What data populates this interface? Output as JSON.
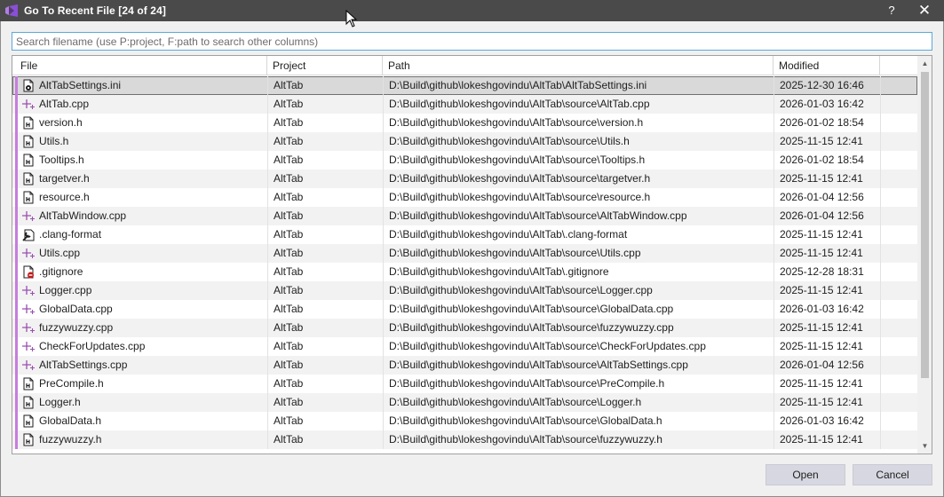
{
  "window": {
    "title": "Go To Recent File [24 of 24]",
    "help_label": "?",
    "close_label": "✕"
  },
  "search": {
    "placeholder": "Search filename (use P:project, F:path to search other columns)",
    "value": ""
  },
  "columns": {
    "file": "File",
    "project": "Project",
    "path": "Path",
    "modified": "Modified"
  },
  "rows": [
    {
      "icon": "settings-file-icon",
      "file": "AltTabSettings.ini",
      "project": "AltTab",
      "path": "D:\\Build\\github\\lokeshgovindu\\AltTab\\AltTabSettings.ini",
      "modified": "2025-12-30 16:46",
      "selected": true
    },
    {
      "icon": "cpp-file-icon",
      "file": "AltTab.cpp",
      "project": "AltTab",
      "path": "D:\\Build\\github\\lokeshgovindu\\AltTab\\source\\AltTab.cpp",
      "modified": "2026-01-03 16:42"
    },
    {
      "icon": "header-file-icon",
      "file": "version.h",
      "project": "AltTab",
      "path": "D:\\Build\\github\\lokeshgovindu\\AltTab\\source\\version.h",
      "modified": "2026-01-02 18:54"
    },
    {
      "icon": "header-file-icon",
      "file": "Utils.h",
      "project": "AltTab",
      "path": "D:\\Build\\github\\lokeshgovindu\\AltTab\\source\\Utils.h",
      "modified": "2025-11-15 12:41"
    },
    {
      "icon": "header-file-icon",
      "file": "Tooltips.h",
      "project": "AltTab",
      "path": "D:\\Build\\github\\lokeshgovindu\\AltTab\\source\\Tooltips.h",
      "modified": "2026-01-02 18:54"
    },
    {
      "icon": "header-file-icon",
      "file": "targetver.h",
      "project": "AltTab",
      "path": "D:\\Build\\github\\lokeshgovindu\\AltTab\\source\\targetver.h",
      "modified": "2025-11-15 12:41"
    },
    {
      "icon": "header-file-icon",
      "file": "resource.h",
      "project": "AltTab",
      "path": "D:\\Build\\github\\lokeshgovindu\\AltTab\\source\\resource.h",
      "modified": "2026-01-04 12:56"
    },
    {
      "icon": "cpp-file-icon",
      "file": "AltTabWindow.cpp",
      "project": "AltTab",
      "path": "D:\\Build\\github\\lokeshgovindu\\AltTab\\source\\AltTabWindow.cpp",
      "modified": "2026-01-04 12:56"
    },
    {
      "icon": "wrench-file-icon",
      "file": ".clang-format",
      "project": "AltTab",
      "path": "D:\\Build\\github\\lokeshgovindu\\AltTab\\.clang-format",
      "modified": "2025-11-15 12:41"
    },
    {
      "icon": "cpp-file-icon",
      "file": "Utils.cpp",
      "project": "AltTab",
      "path": "D:\\Build\\github\\lokeshgovindu\\AltTab\\source\\Utils.cpp",
      "modified": "2025-11-15 12:41"
    },
    {
      "icon": "gitignore-file-icon",
      "file": ".gitignore",
      "project": "AltTab",
      "path": "D:\\Build\\github\\lokeshgovindu\\AltTab\\.gitignore",
      "modified": "2025-12-28 18:31"
    },
    {
      "icon": "cpp-file-icon",
      "file": "Logger.cpp",
      "project": "AltTab",
      "path": "D:\\Build\\github\\lokeshgovindu\\AltTab\\source\\Logger.cpp",
      "modified": "2025-11-15 12:41"
    },
    {
      "icon": "cpp-file-icon",
      "file": "GlobalData.cpp",
      "project": "AltTab",
      "path": "D:\\Build\\github\\lokeshgovindu\\AltTab\\source\\GlobalData.cpp",
      "modified": "2026-01-03 16:42"
    },
    {
      "icon": "cpp-file-icon",
      "file": "fuzzywuzzy.cpp",
      "project": "AltTab",
      "path": "D:\\Build\\github\\lokeshgovindu\\AltTab\\source\\fuzzywuzzy.cpp",
      "modified": "2025-11-15 12:41"
    },
    {
      "icon": "cpp-file-icon",
      "file": "CheckForUpdates.cpp",
      "project": "AltTab",
      "path": "D:\\Build\\github\\lokeshgovindu\\AltTab\\source\\CheckForUpdates.cpp",
      "modified": "2025-11-15 12:41"
    },
    {
      "icon": "cpp-file-icon",
      "file": "AltTabSettings.cpp",
      "project": "AltTab",
      "path": "D:\\Build\\github\\lokeshgovindu\\AltTab\\source\\AltTabSettings.cpp",
      "modified": "2026-01-04 12:56"
    },
    {
      "icon": "header-file-icon",
      "file": "PreCompile.h",
      "project": "AltTab",
      "path": "D:\\Build\\github\\lokeshgovindu\\AltTab\\source\\PreCompile.h",
      "modified": "2025-11-15 12:41"
    },
    {
      "icon": "header-file-icon",
      "file": "Logger.h",
      "project": "AltTab",
      "path": "D:\\Build\\github\\lokeshgovindu\\AltTab\\source\\Logger.h",
      "modified": "2025-11-15 12:41"
    },
    {
      "icon": "header-file-icon",
      "file": "GlobalData.h",
      "project": "AltTab",
      "path": "D:\\Build\\github\\lokeshgovindu\\AltTab\\source\\GlobalData.h",
      "modified": "2026-01-03 16:42"
    },
    {
      "icon": "header-file-icon",
      "file": "fuzzywuzzy.h",
      "project": "AltTab",
      "path": "D:\\Build\\github\\lokeshgovindu\\AltTab\\source\\fuzzywuzzy.h",
      "modified": "2025-11-15 12:41"
    }
  ],
  "buttons": {
    "open": "Open",
    "cancel": "Cancel"
  },
  "colors": {
    "titlebar": "#4a4a4a",
    "accent": "#c77ddc",
    "cpp_icon": "#9b4fb0",
    "gitignore_badge": "#c41a1a",
    "selection": "#d9d9d9",
    "button": "#d6d7e0"
  }
}
